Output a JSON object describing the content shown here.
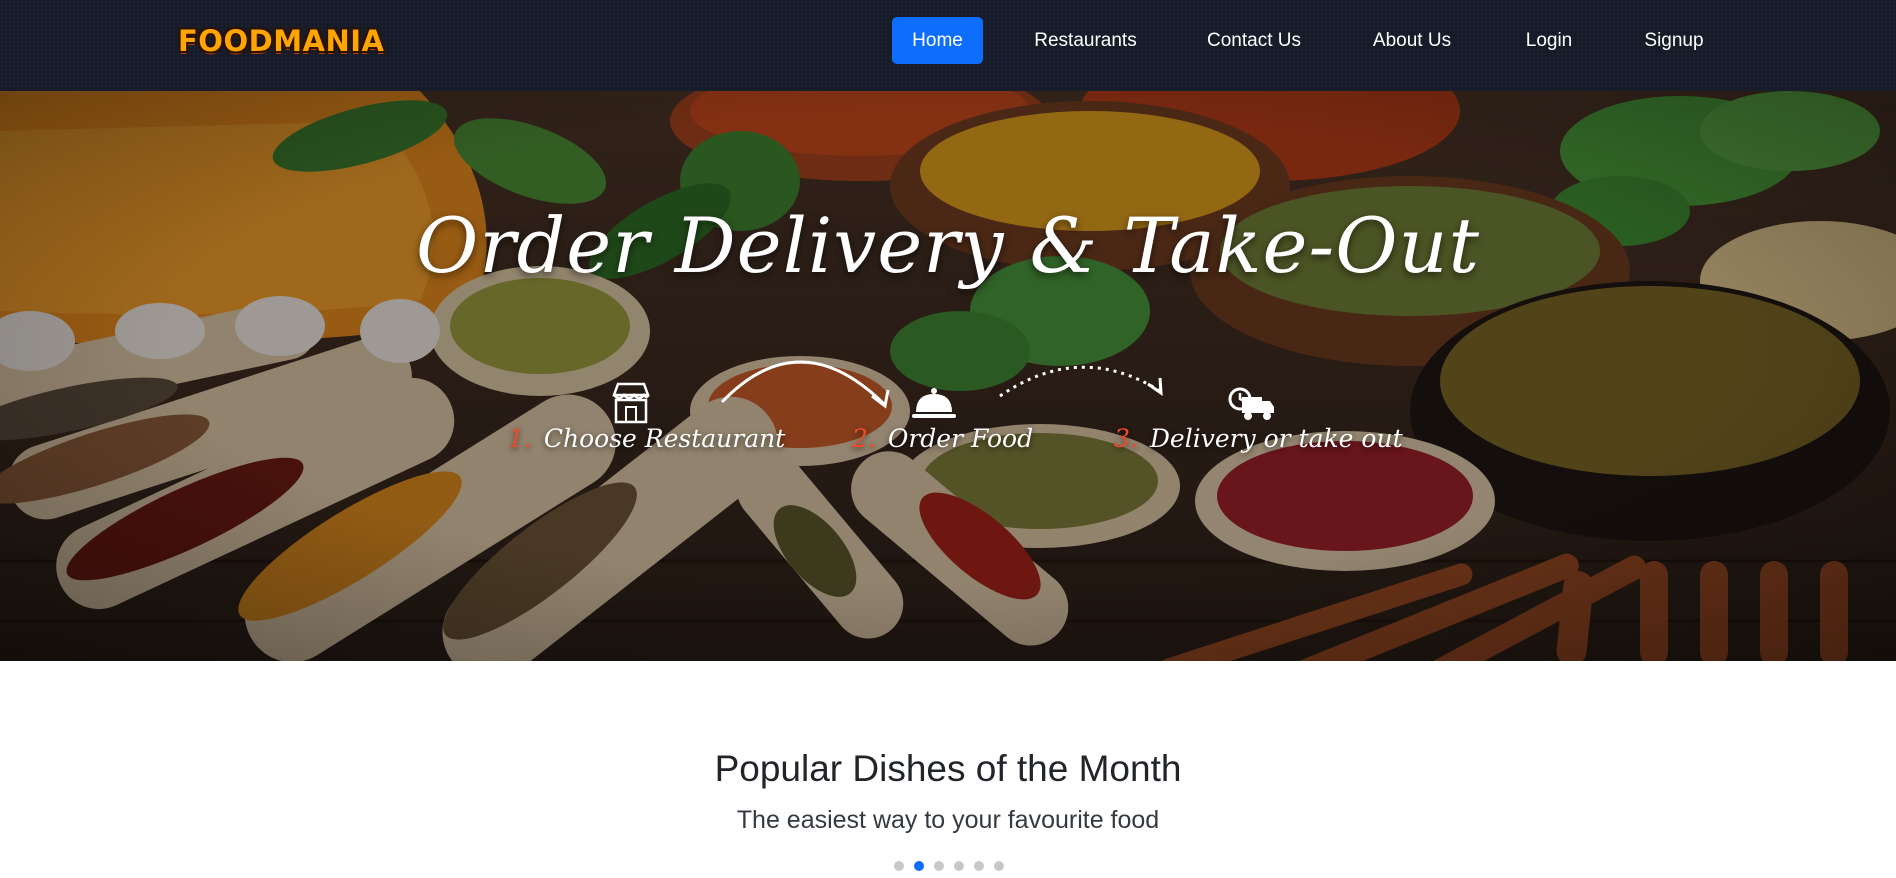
{
  "nav": {
    "logo": "FOODMANIA",
    "links": [
      {
        "label": "Home",
        "active": true
      },
      {
        "label": "Restaurants",
        "active": false
      },
      {
        "label": "Contact Us",
        "active": false
      },
      {
        "label": "About Us",
        "active": false
      },
      {
        "label": "Login",
        "active": false
      },
      {
        "label": "Signup",
        "active": false
      }
    ]
  },
  "hero": {
    "title": "Order Delivery & Take-Out",
    "steps": [
      {
        "number": "1.",
        "label": "Choose Restaurant",
        "icon": "storefront-icon"
      },
      {
        "number": "2.",
        "label": "Order Food",
        "icon": "cloche-icon"
      },
      {
        "number": "3.",
        "label": "Delivery or take out",
        "icon": "delivery-truck-icon"
      }
    ]
  },
  "popular": {
    "title": "Popular Dishes of the Month",
    "subtitle": "The easiest way to your favourite food",
    "carousel_total": 6,
    "carousel_active": 2
  },
  "colors": {
    "navbar_bg": "#151b28",
    "accent": "#0d6efd",
    "logo": "#ffa500",
    "step_number": "#f04a2a"
  }
}
